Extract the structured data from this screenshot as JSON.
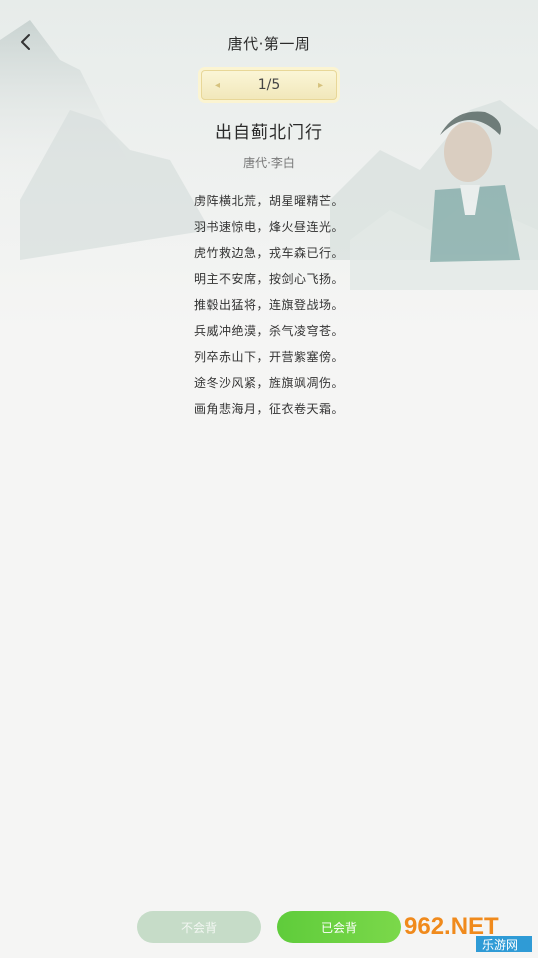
{
  "header": {
    "title": "唐代·第一周"
  },
  "pager": {
    "prev_icon": "◂",
    "next_icon": "▸",
    "count": "1/5"
  },
  "poem": {
    "title": "出自蓟北门行",
    "author": "唐代·李白",
    "lines": [
      "虏阵横北荒，胡星曜精芒。",
      "羽书速惊电，烽火昼连光。",
      "虎竹救边急，戎车森已行。",
      "明主不安席，按剑心飞扬。",
      "推毂出猛将，连旗登战场。",
      "兵威冲绝漠，杀气凌穹苍。",
      "列卒赤山下，开营紫塞傍。",
      "途冬沙风紧，旌旗飒凋伤。",
      "画角悲海月，征衣卷天霜。"
    ]
  },
  "actions": {
    "not_memorized": "不会背",
    "memorized": "已会背"
  },
  "watermark": {
    "main": "962.NET",
    "sub": "乐游网"
  },
  "colors": {
    "accent_green": "#5fcc3b",
    "disabled_green": "#c6dcc8",
    "pager_gold": "#f1e7ba"
  }
}
